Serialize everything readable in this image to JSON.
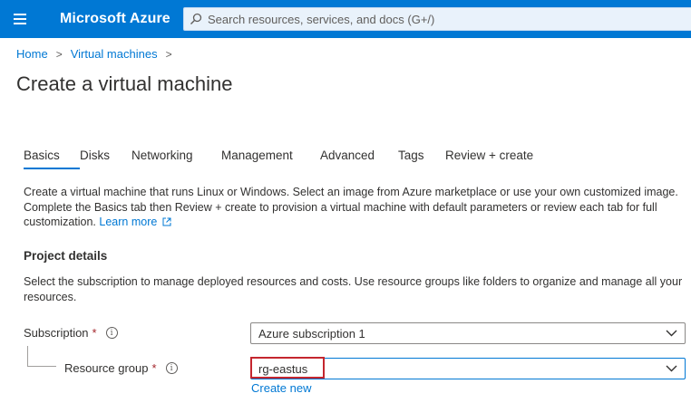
{
  "header": {
    "menu_icon": "hamburger-icon",
    "brand": "Microsoft Azure",
    "search": {
      "icon": "search-icon",
      "placeholder": "Search resources, services, and docs (G+/)"
    },
    "color": "#0078d4"
  },
  "breadcrumb": [
    {
      "label": "Home"
    },
    {
      "label": "Virtual machines"
    }
  ],
  "breadcrumb_separator": ">",
  "page_title": "Create a virtual machine",
  "tabs": [
    {
      "label": "Basics",
      "active": true
    },
    {
      "label": "Disks"
    },
    {
      "label": "Networking"
    },
    {
      "label": "Management"
    },
    {
      "label": "Advanced"
    },
    {
      "label": "Tags"
    },
    {
      "label": "Review + create"
    }
  ],
  "intro": {
    "text": "Create a virtual machine that runs Linux or Windows. Select an image from Azure marketplace or use your own customized image. Complete the Basics tab then Review + create to provision a virtual machine with default parameters or review each tab for full customization.",
    "learn_more": "Learn more",
    "learn_more_icon": "external-link-icon"
  },
  "project_details": {
    "title": "Project details",
    "description": "Select the subscription to manage deployed resources and costs. Use resource groups like folders to organize and manage all your resources.",
    "subscription": {
      "label": "Subscription",
      "required": "*",
      "info_icon": "info-icon",
      "value": "Azure subscription 1"
    },
    "resource_group": {
      "label": "Resource group",
      "required": "*",
      "info_icon": "info-icon",
      "value": "rg-eastus",
      "create_new": "Create new"
    }
  },
  "colors": {
    "accent": "#0078d4",
    "required": "#a4262c",
    "highlight_box": "#c4262e"
  }
}
